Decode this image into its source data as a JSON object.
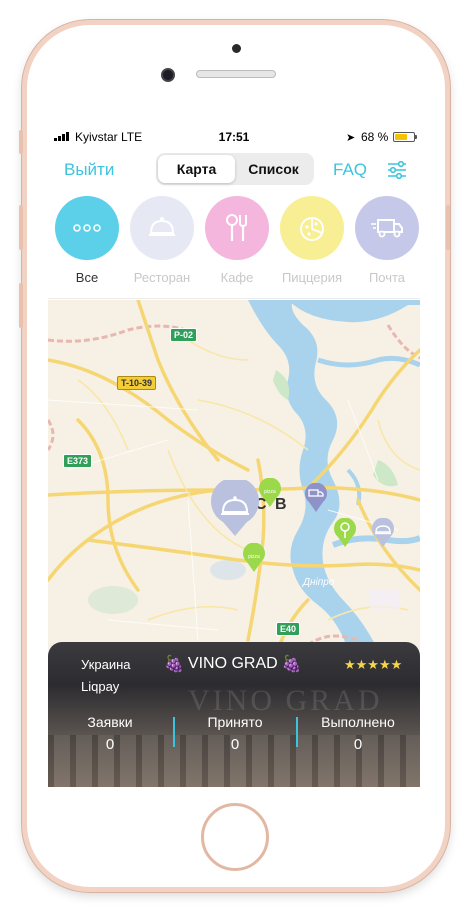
{
  "status_bar": {
    "carrier": "Kyivstar LTE",
    "time": "17:51",
    "battery_percent": "68 %",
    "battery_level": 0.68
  },
  "nav": {
    "logout_label": "Выйти",
    "tabs": [
      {
        "label": "Карта",
        "active": true
      },
      {
        "label": "Список",
        "active": false
      }
    ],
    "faq_label": "FAQ",
    "filter_icon": "sliders-icon"
  },
  "categories": [
    {
      "label": "Все",
      "icon": "dots-icon",
      "color": "#5bd0e8",
      "active": true
    },
    {
      "label": "Ресторан",
      "icon": "cloche-icon",
      "color": "#e6e8f4",
      "active": false
    },
    {
      "label": "Кафе",
      "icon": "cutlery-icon",
      "color": "#f4b6dc",
      "active": false
    },
    {
      "label": "Пиццерия",
      "icon": "pizza-icon",
      "color": "#f8ef94",
      "active": false
    },
    {
      "label": "Почта",
      "icon": "truck-icon",
      "color": "#c6c8ea",
      "active": false
    }
  ],
  "map": {
    "road_badges": [
      "P-02",
      "T-10-39",
      "E373",
      "E40"
    ],
    "city_label": "С В",
    "river_label": "Днiпро"
  },
  "card": {
    "country": "Украина",
    "payment": "Liqpay",
    "venue_name": "VINO GRAD",
    "background_sign": "VINO GRAD",
    "rating": "★★★★★",
    "stats": [
      {
        "label": "Заявки",
        "value": "0"
      },
      {
        "label": "Принято",
        "value": "0"
      },
      {
        "label": "Выполнено",
        "value": "0"
      }
    ]
  },
  "colors": {
    "accent": "#3cc3e0",
    "frame": "#f2d2c2",
    "map_water": "#a9d3ec",
    "map_road": "#f6d673"
  }
}
